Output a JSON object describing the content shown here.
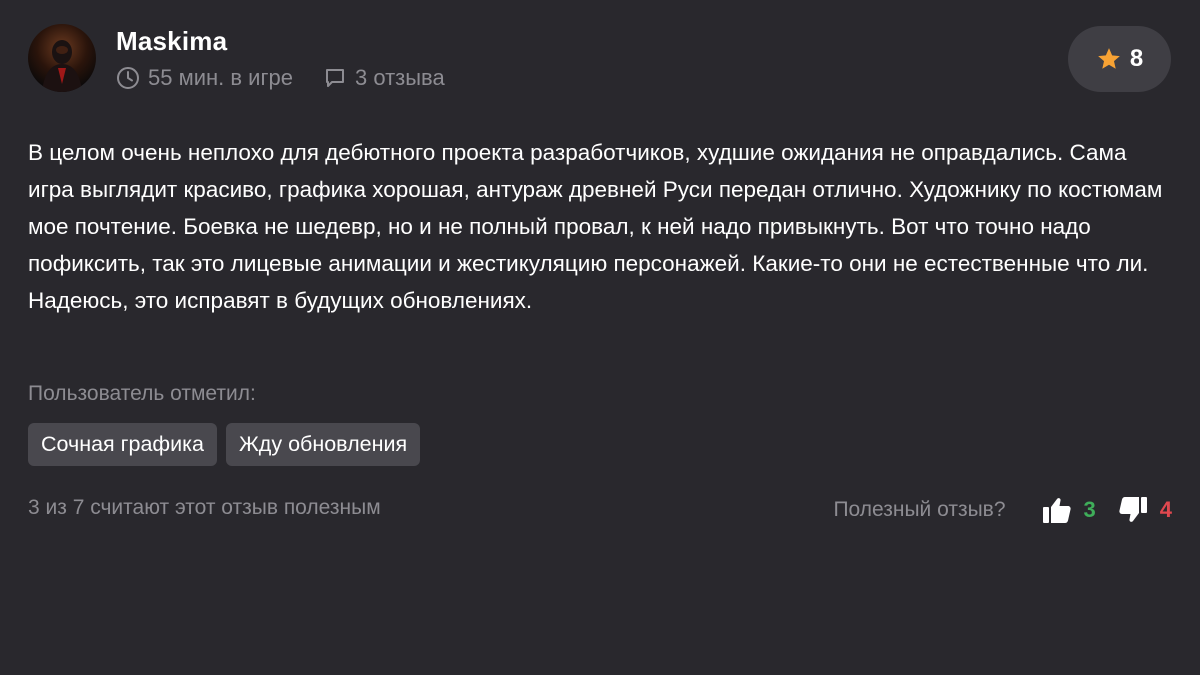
{
  "user": {
    "name": "Maskima",
    "playtime": "55 мин. в игре",
    "reviews": "3 отзыва"
  },
  "rating": {
    "value": "8",
    "icon": "star-icon",
    "color": "#f7a234"
  },
  "review": {
    "text": "В целом очень неплохо для дебютного проекта разработчиков, худшие ожидания не оправдались. Сама игра выглядит красиво, графика хорошая, антураж древней Руси передан отлично. Художнику по костюмам мое почтение. Боевка не шедевр, но и не полный провал, к ней надо привыкнуть. Вот что точно надо пофиксить, так это лицевые анимации и жестикуляцию персонажей. Какие-то они не естественные что ли. Надеюсь, это исправят в будущих обновлениях."
  },
  "tags": {
    "label": "Пользователь отметил:",
    "items": [
      "Сочная графика",
      "Жду обновления"
    ]
  },
  "footer": {
    "helpful_summary": "3 из 7 считают этот отзыв полезным",
    "question": "Полезный отзыв?",
    "upvotes": "3",
    "downvotes": "4",
    "upvote_color": "#3fae5a",
    "downvote_color": "#e0484f"
  }
}
